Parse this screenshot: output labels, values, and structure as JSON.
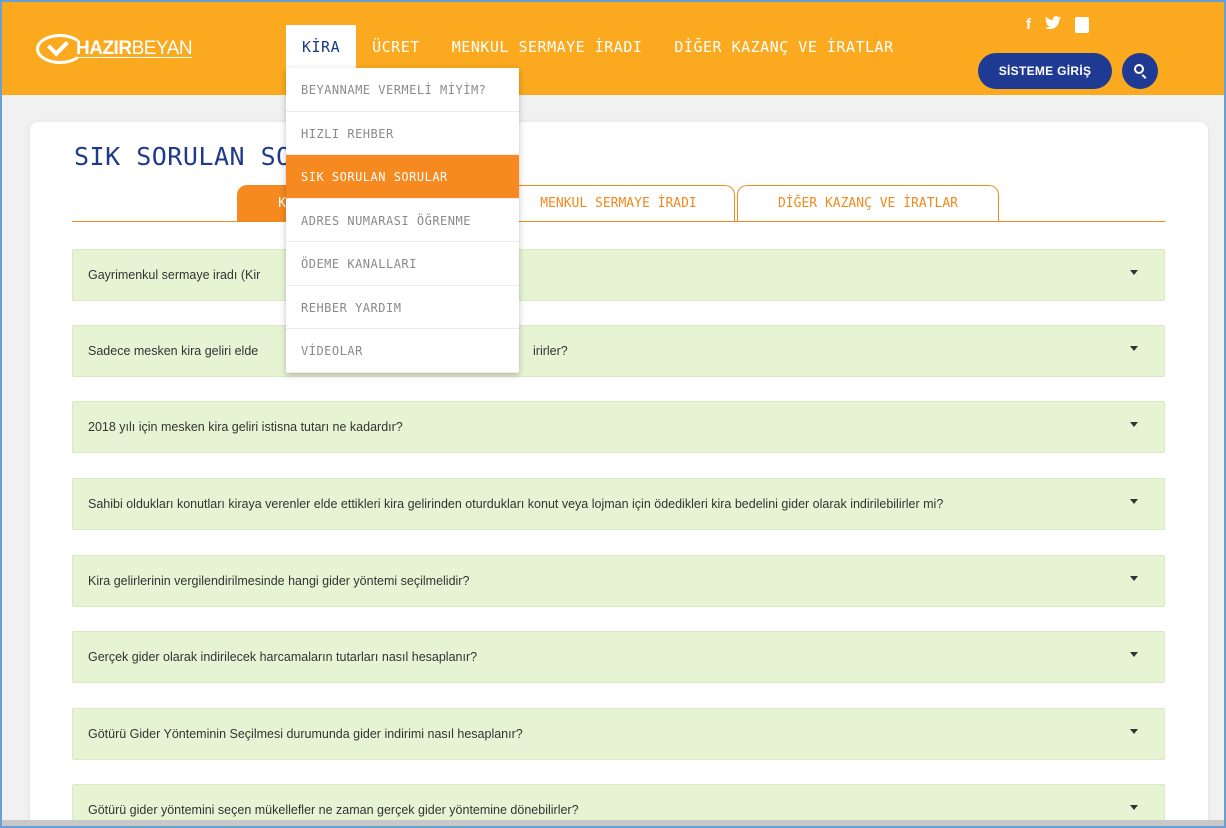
{
  "header": {
    "logo_bold": "HAZIR",
    "logo_light": "BEYAN",
    "nav": [
      {
        "label": "KİRA",
        "active": true
      },
      {
        "label": "ÜCRET",
        "active": false
      },
      {
        "label": "MENKUL SERMAYE İRADI",
        "active": false
      },
      {
        "label": "DİĞER KAZANÇ VE İRATLAR",
        "active": false
      }
    ],
    "social": {
      "facebook": "f",
      "twitter": "t",
      "youtube_icon": "youtube-icon"
    },
    "login_label": "SİSTEME GİRİŞ"
  },
  "dropdown": {
    "items": [
      {
        "label": "BEYANNAME VERMELİ MİYİM?",
        "active": false
      },
      {
        "label": "HIZLI REHBER",
        "active": false
      },
      {
        "label": "SIK SORULAN SORULAR",
        "active": true
      },
      {
        "label": "ADRES NUMARASI ÖĞRENME",
        "active": false
      },
      {
        "label": "ÖDEME KANALLARI",
        "active": false
      },
      {
        "label": "REHBER YARDIM",
        "active": false
      },
      {
        "label": "VİDEOLAR",
        "active": false
      }
    ]
  },
  "main": {
    "title": "SIK SORULAN SOR",
    "tabs": [
      {
        "label": "K",
        "active": true
      },
      {
        "label": "MENKUL SERMAYE İRADI",
        "active": false
      },
      {
        "label": "DİĞER KAZANÇ VE İRATLAR",
        "active": false
      }
    ],
    "faq": [
      {
        "question": "Gayrimenkul sermaye iradı (Kir"
      },
      {
        "question": "Sadece mesken kira geliri elde"
      },
      {
        "question": "2018 yılı için mesken kira geliri istisna tutarı ne kadardır?"
      },
      {
        "question": "Sahibi oldukları konutları kiraya verenler elde ettikleri kira gelirinden oturdukları konut veya lojman için ödedikleri kira bedelini gider olarak indirilebilirler mi?"
      },
      {
        "question": "Kira gelirlerinin vergilendirilmesinde hangi gider yöntemi seçilmelidir?"
      },
      {
        "question": "Gerçek gider olarak indirilecek harcamaların tutarları nasıl hesaplanır?"
      },
      {
        "question": "Götürü Gider Yönteminin Seçilmesi durumunda gider indirimi nasıl hesaplanır?"
      },
      {
        "question": "Götürü gider yöntemini seçen mükellefler ne zaman gerçek gider yöntemine dönebilirler?"
      }
    ],
    "faq2_suffix": "irirler?"
  },
  "colors": {
    "header_bg": "#fbaa1f",
    "accent_orange": "#f6891f",
    "brand_blue": "#1f3a93",
    "faq_bg": "#e7f4d4"
  }
}
